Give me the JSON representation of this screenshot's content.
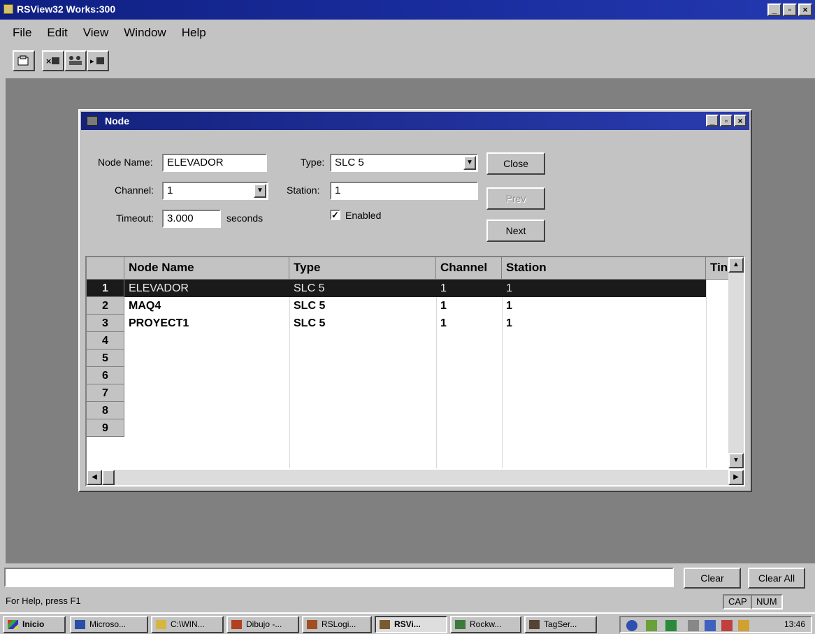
{
  "app": {
    "title": "RSView32 Works:300",
    "window_buttons": [
      "_",
      "▫",
      "×"
    ]
  },
  "menu": [
    "File",
    "Edit",
    "View",
    "Window",
    "Help"
  ],
  "toolbar": {
    "icons": [
      "open-icon",
      "remove-node-icon",
      "nodes-icon",
      "add-node-icon"
    ]
  },
  "node_window": {
    "title": "Node",
    "form": {
      "node_name_label": "Node Name:",
      "node_name_value": "ELEVADOR",
      "type_label": "Type:",
      "type_value": "SLC 5",
      "channel_label": "Channel:",
      "channel_value": "1",
      "station_label": "Station:",
      "station_value": "1",
      "timeout_label": "Timeout:",
      "timeout_value": "3.000",
      "timeout_unit": "seconds",
      "enabled_label": "Enabled",
      "enabled_checked": true
    },
    "buttons": {
      "close": "Close",
      "prev": "Prev",
      "next": "Next"
    },
    "grid": {
      "columns": [
        "Node Name",
        "Type",
        "Channel",
        "Station",
        "Tin"
      ],
      "rows": [
        {
          "n": "1",
          "name": "ELEVADOR",
          "type": "SLC 5",
          "channel": "1",
          "station": "1"
        },
        {
          "n": "2",
          "name": "MAQ4",
          "type": "SLC 5",
          "channel": "1",
          "station": "1"
        },
        {
          "n": "3",
          "name": "PROYECT1",
          "type": "SLC 5",
          "channel": "1",
          "station": "1"
        },
        {
          "n": "4",
          "name": "",
          "type": "",
          "channel": "",
          "station": ""
        },
        {
          "n": "5",
          "name": "",
          "type": "",
          "channel": "",
          "station": ""
        },
        {
          "n": "6",
          "name": "",
          "type": "",
          "channel": "",
          "station": ""
        },
        {
          "n": "7",
          "name": "",
          "type": "",
          "channel": "",
          "station": ""
        },
        {
          "n": "8",
          "name": "",
          "type": "",
          "channel": "",
          "station": ""
        },
        {
          "n": "9",
          "name": "",
          "type": "",
          "channel": "",
          "station": ""
        }
      ],
      "selected_row": "1"
    }
  },
  "message_bar": {
    "clear": "Clear",
    "clear_all": "Clear All"
  },
  "status": {
    "help": "For Help, press F1",
    "cap": "CAP",
    "num": "NUM"
  },
  "taskbar": {
    "start": "Inicio",
    "tasks": [
      "Microso...",
      "C:\\WIN...",
      "Dibujo -...",
      "RSLogi...",
      "RSVi...",
      "Rockw...",
      "TagSer..."
    ],
    "active_task": "RSVi...",
    "clock": "13:46"
  }
}
